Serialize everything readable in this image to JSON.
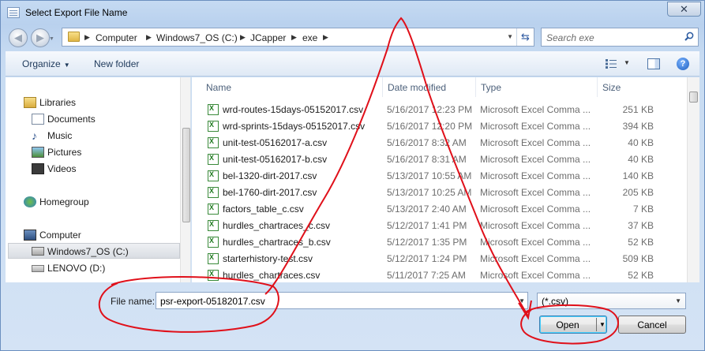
{
  "window": {
    "title": "Select Export File Name",
    "close_label": "✕"
  },
  "nav": {
    "back_icon": "back-arrow-icon",
    "forward_icon": "forward-arrow-icon"
  },
  "address": {
    "crumbs": [
      "Computer",
      "Windows7_OS (C:)",
      "JCapper",
      "exe"
    ]
  },
  "search": {
    "placeholder": "Search exe"
  },
  "toolbar": {
    "organize_label": "Organize",
    "new_folder_label": "New folder"
  },
  "sidebar": {
    "items": [
      {
        "label": "Libraries",
        "icon": "libraries-icon"
      },
      {
        "label": "Documents",
        "icon": "documents-icon"
      },
      {
        "label": "Music",
        "icon": "music-icon"
      },
      {
        "label": "Pictures",
        "icon": "pictures-icon"
      },
      {
        "label": "Videos",
        "icon": "videos-icon"
      },
      {
        "label": "Homegroup",
        "icon": "homegroup-icon"
      },
      {
        "label": "Computer",
        "icon": "computer-icon"
      },
      {
        "label": "Windows7_OS (C:)",
        "icon": "drive-icon",
        "selected": true
      },
      {
        "label": "LENOVO (D:)",
        "icon": "drive-icon"
      }
    ]
  },
  "columns": {
    "name": "Name",
    "date": "Date modified",
    "type": "Type",
    "size": "Size"
  },
  "files": [
    {
      "name": "wrd-routes-15days-05152017.csv",
      "date": "5/16/2017 12:23 PM",
      "type": "Microsoft Excel Comma ...",
      "size": "251 KB"
    },
    {
      "name": "wrd-sprints-15days-05152017.csv",
      "date": "5/16/2017 12:20 PM",
      "type": "Microsoft Excel Comma ...",
      "size": "394 KB"
    },
    {
      "name": "unit-test-05162017-a.csv",
      "date": "5/16/2017 8:32 AM",
      "type": "Microsoft Excel Comma ...",
      "size": "40 KB"
    },
    {
      "name": "unit-test-05162017-b.csv",
      "date": "5/16/2017 8:31 AM",
      "type": "Microsoft Excel Comma ...",
      "size": "40 KB"
    },
    {
      "name": "bel-1320-dirt-2017.csv",
      "date": "5/13/2017 10:55 AM",
      "type": "Microsoft Excel Comma ...",
      "size": "140 KB"
    },
    {
      "name": "bel-1760-dirt-2017.csv",
      "date": "5/13/2017 10:25 AM",
      "type": "Microsoft Excel Comma ...",
      "size": "205 KB"
    },
    {
      "name": "factors_table_c.csv",
      "date": "5/13/2017 2:40 AM",
      "type": "Microsoft Excel Comma ...",
      "size": "7 KB"
    },
    {
      "name": "hurdles_chartraces_c.csv",
      "date": "5/12/2017 1:41 PM",
      "type": "Microsoft Excel Comma ...",
      "size": "37 KB"
    },
    {
      "name": "hurdles_chartraces_b.csv",
      "date": "5/12/2017 1:35 PM",
      "type": "Microsoft Excel Comma ...",
      "size": "52 KB"
    },
    {
      "name": "starterhistory-test.csv",
      "date": "5/12/2017 1:24 PM",
      "type": "Microsoft Excel Comma ...",
      "size": "509 KB"
    },
    {
      "name": "hurdles_chartraces.csv",
      "date": "5/11/2017 7:25 AM",
      "type": "Microsoft Excel Comma ...",
      "size": "52 KB"
    }
  ],
  "footer": {
    "file_name_label": "File name:",
    "file_name_value": "psr-export-05182017.csv",
    "file_type_value": "(*.csv)",
    "open_label": "Open",
    "cancel_label": "Cancel"
  },
  "colors": {
    "annotation": "#e0101a",
    "window_frame": "#b9d1ee"
  }
}
